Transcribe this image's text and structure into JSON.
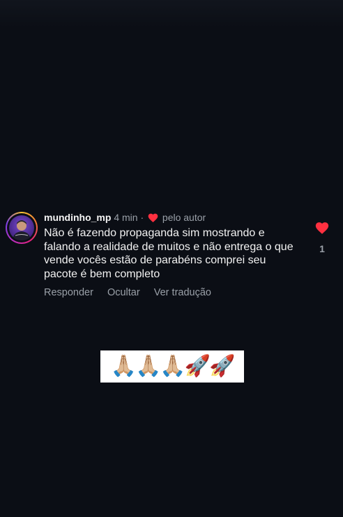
{
  "comment": {
    "username": "mundinho_mp",
    "time": "4 min",
    "separator": "·",
    "liked_by": "pelo autor",
    "text": "Não é fazendo propaganda sim mostrando e falando a realidade de muitos e não entrega o que vende vocês estão de parabéns comprei seu pacote é bem completo",
    "actions": {
      "reply": "Responder",
      "hide": "Ocultar",
      "translate": "Ver tradução"
    },
    "like_count": "1",
    "icons": {
      "like": "heart-icon",
      "author_like": "heart-icon"
    },
    "colors": {
      "heart": "#ff3040",
      "background": "#0b0e15"
    }
  },
  "sticker": {
    "emojis": "🙏🏼🙏🏼🙏🏼🚀🚀"
  }
}
